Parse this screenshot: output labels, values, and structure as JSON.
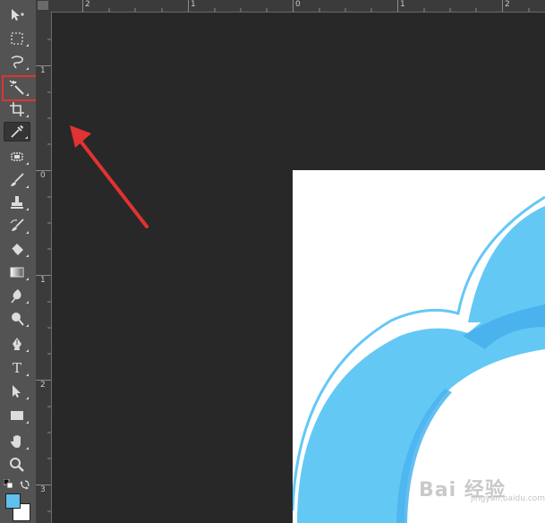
{
  "ruler_top_labels": [
    "2",
    "1",
    "0",
    "1",
    "2"
  ],
  "ruler_left_labels": [
    "1",
    "0",
    "1",
    "2",
    "3"
  ],
  "tools": [
    {
      "name": "move-tool",
      "icon": "move-icon"
    },
    {
      "name": "marquee-tool",
      "icon": "marquee-icon"
    },
    {
      "name": "lasso-tool",
      "icon": "lasso-icon"
    },
    {
      "name": "magic-wand-tool",
      "icon": "magic-wand-icon"
    },
    {
      "name": "crop-tool",
      "icon": "crop-icon"
    },
    {
      "name": "eyedropper-tool",
      "icon": "eyedropper-icon",
      "active": true
    },
    {
      "name": "healing-brush-tool",
      "icon": "healing-brush-icon"
    },
    {
      "name": "brush-tool",
      "icon": "brush-icon"
    },
    {
      "name": "clone-stamp-tool",
      "icon": "stamp-icon"
    },
    {
      "name": "history-brush-tool",
      "icon": "history-brush-icon"
    },
    {
      "name": "eraser-tool",
      "icon": "eraser-icon"
    },
    {
      "name": "gradient-tool",
      "icon": "gradient-icon"
    },
    {
      "name": "blur-tool",
      "icon": "blur-icon"
    },
    {
      "name": "dodge-tool",
      "icon": "dodge-icon"
    },
    {
      "name": "pen-tool",
      "icon": "pen-icon"
    },
    {
      "name": "type-tool",
      "icon": "type-icon",
      "label": "T"
    },
    {
      "name": "path-selection-tool",
      "icon": "arrow-icon"
    },
    {
      "name": "rectangle-tool",
      "icon": "rectangle-icon"
    },
    {
      "name": "hand-tool",
      "icon": "hand-icon"
    },
    {
      "name": "zoom-tool",
      "icon": "zoom-icon"
    }
  ],
  "type_tool_label": "T",
  "colors": {
    "foreground": "#5fc0ee",
    "background": "#ffffff",
    "highlight": "#e23232",
    "cloud_light": "#64c8f5",
    "cloud_mid": "#4ab3ee"
  },
  "watermark": {
    "text": "Bai 经验",
    "sub": "jingyan.baidu.com"
  }
}
